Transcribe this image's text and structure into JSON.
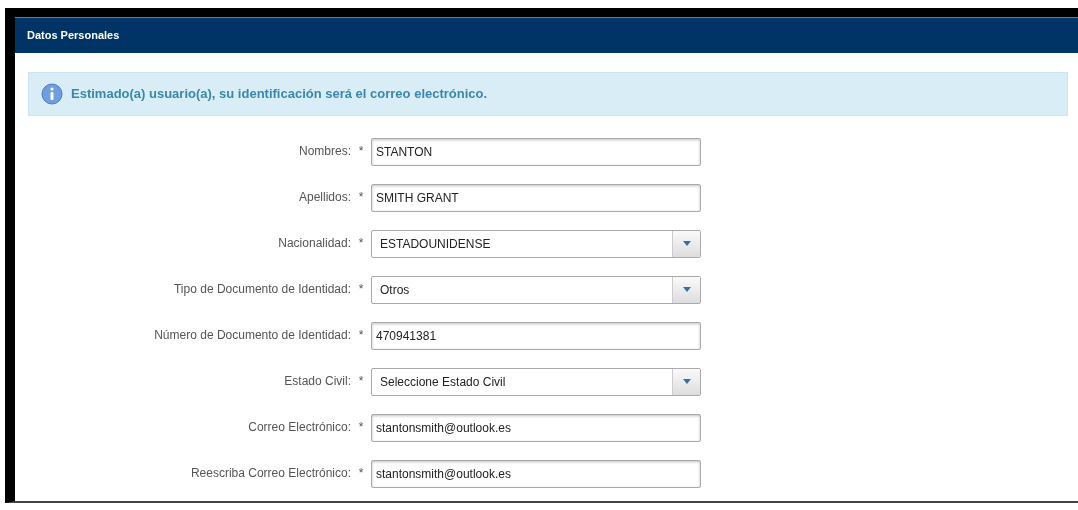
{
  "panel": {
    "title": "Datos Personales"
  },
  "alert": {
    "message": "Estimado(a) usuario(a), su identificación será el correo electrónico."
  },
  "fields": [
    {
      "label": "Nombres:",
      "required_mark": "*",
      "kind": "text",
      "value": "STANTON"
    },
    {
      "label": "Apellidos:",
      "required_mark": "*",
      "kind": "text",
      "value": "SMITH GRANT"
    },
    {
      "label": "Nacionalidad:",
      "required_mark": "*",
      "kind": "select",
      "value": "ESTADOUNIDENSE"
    },
    {
      "label": "Tipo de Documento de Identidad:",
      "required_mark": "*",
      "kind": "select",
      "value": "Otros"
    },
    {
      "label": "Número de Documento de Identidad:",
      "required_mark": "*",
      "kind": "text",
      "value": "470941381"
    },
    {
      "label": "Estado Civil:",
      "required_mark": "*",
      "kind": "select",
      "value": "Seleccione Estado Civil"
    },
    {
      "label": "Correo Electrónico:",
      "required_mark": "*",
      "kind": "text",
      "value": "stantonsmith@outlook.es"
    },
    {
      "label": "Reescriba Correo Electrónico:",
      "required_mark": "*",
      "kind": "text",
      "value": "stantonsmith@outlook.es"
    }
  ]
}
